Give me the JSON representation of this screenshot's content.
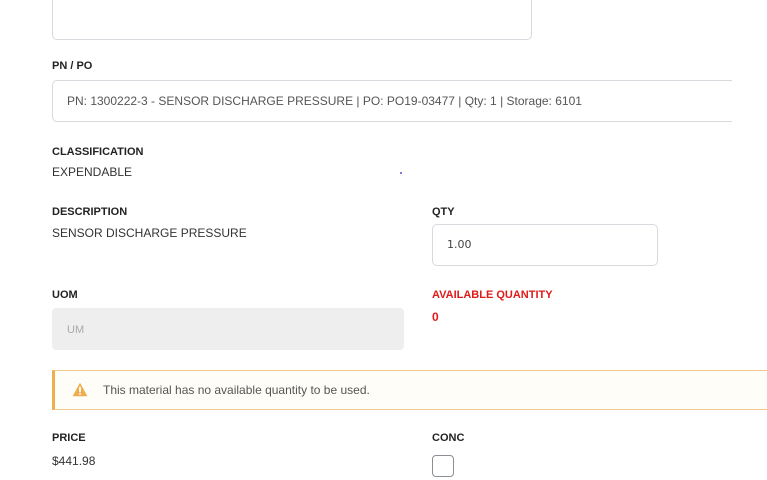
{
  "form": {
    "pn_po": {
      "label": "PN / PO",
      "value": "PN: 1300222-3 - SENSOR DISCHARGE PRESSURE | PO: PO19-03477 | Qty: 1 | Storage: 6101"
    },
    "classification": {
      "label": "CLASSIFICATION",
      "value": "EXPENDABLE"
    },
    "description": {
      "label": "DESCRIPTION",
      "value": "SENSOR DISCHARGE PRESSURE"
    },
    "qty": {
      "label": "QTY",
      "value": "1.00"
    },
    "uom": {
      "label": "UOM",
      "placeholder": "UM"
    },
    "available_quantity": {
      "label": "AVAILABLE QUANTITY",
      "value": "0",
      "color": "#e11919"
    },
    "alert": {
      "message": "This material has no available quantity to be used.",
      "icon": "warning-icon",
      "color": "#f0ad4e"
    },
    "price": {
      "label": "PRICE",
      "value": "$441.98"
    },
    "conc": {
      "label": "CONC",
      "checked": false
    }
  }
}
